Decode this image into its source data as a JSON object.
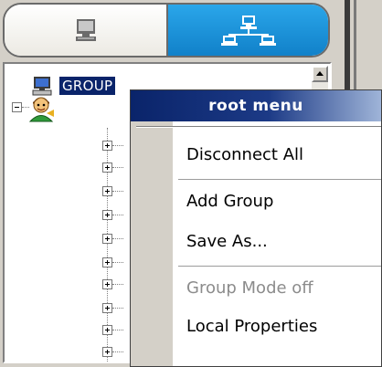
{
  "tabs": {
    "left_icon": "computer-icon",
    "right_icon": "network-icon",
    "active": "right"
  },
  "tree": {
    "root_label": "GROUP",
    "root_icon": "computer-icon",
    "child_icon": "user-icon",
    "collapsed_children": 11
  },
  "context_menu": {
    "title": "root menu",
    "items": [
      {
        "label": "Disconnect All",
        "enabled": true
      },
      {
        "label": "Add Group",
        "enabled": true
      },
      {
        "label": "Save As...",
        "enabled": true
      },
      {
        "label": "Group Mode off",
        "enabled": false
      },
      {
        "label": "Local Properties",
        "enabled": true
      }
    ]
  },
  "colors": {
    "selection": "#0a246a",
    "tab_active": "#1a8fd8",
    "menu_header": "#0a246a",
    "disabled_text": "#8c8c8c"
  }
}
